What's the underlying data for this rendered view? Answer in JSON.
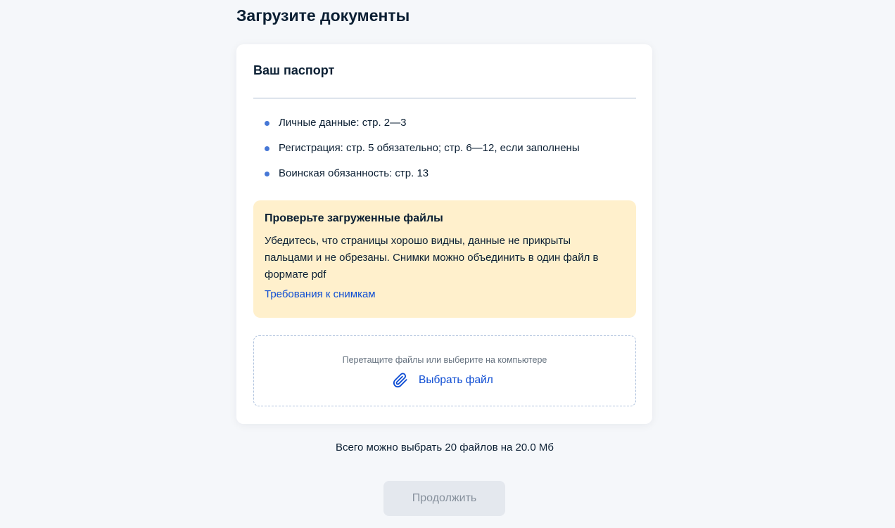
{
  "page": {
    "title": "Загрузите документы"
  },
  "card": {
    "title": "Ваш паспорт",
    "pages": [
      "Личные данные: стр. 2—3",
      "Регистрация: стр. 5 обязательно; стр. 6—12, если заполнены",
      "Воинская обязанность: стр. 13"
    ],
    "notice": {
      "title": "Проверьте загруженные файлы",
      "text": "Убедитесь, что страницы хорошо видны, данные не прикрыты пальцами и не обрезаны. Снимки можно объединить в один файл в формате pdf",
      "link": "Требования к снимкам"
    },
    "dropzone": {
      "hint": "Перетащите файлы или выберите на компьютере",
      "choose_label": "Выбрать файл",
      "icon": "paperclip-icon"
    }
  },
  "limits": "Всего можно выбрать 20 файлов на 20.0 Мб",
  "actions": {
    "continue_label": "Продолжить"
  },
  "colors": {
    "background": "#f5f7fa",
    "card": "#ffffff",
    "text": "#0b1f33",
    "link": "#0d4cd3",
    "bullet": "#4677d6",
    "notice_background": "#fff0cc",
    "dropzone_border": "#b0c3de",
    "button_disabled_background": "#e4e8ee",
    "button_disabled_text": "#86909c"
  }
}
